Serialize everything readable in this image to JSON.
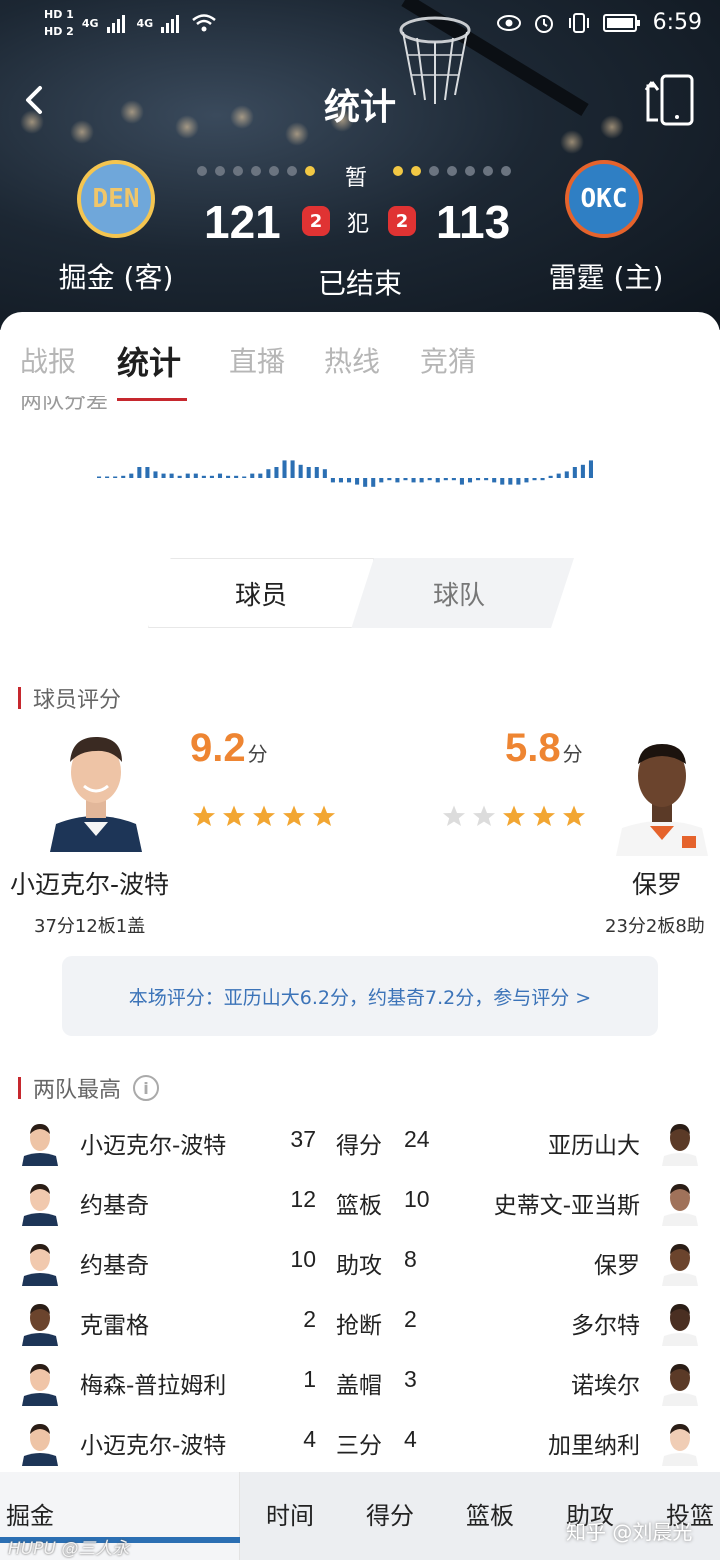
{
  "status_bar": {
    "hd1": "HD 1",
    "hd2": "HD 2",
    "net1": "4G",
    "net2": "4G",
    "time": "6:59"
  },
  "nav": {
    "title": "统计"
  },
  "game": {
    "away": {
      "abbr": "DEN",
      "name": "掘金 (客)",
      "score": "121",
      "fouls": "2",
      "timeouts_total": 7,
      "timeouts_used": 1,
      "logo_color": "#6fa7da"
    },
    "home": {
      "abbr": "OKC",
      "name": "雷霆 (主)",
      "score": "113",
      "fouls": "2",
      "timeouts_total": 7,
      "timeouts_used": 2,
      "logo_color": "#2f7fc4"
    },
    "timeout_label": "暂",
    "foul_label": "犯",
    "status": "已结束"
  },
  "tabs": [
    {
      "label": "战报"
    },
    {
      "label": "统计"
    },
    {
      "label": "直播"
    },
    {
      "label": "热线"
    },
    {
      "label": "竞猜"
    }
  ],
  "diff_section_title": "两队分差",
  "switch": {
    "player": "球员",
    "team": "球队"
  },
  "player_rating": {
    "title": "球员评分",
    "away": {
      "name": "小迈克尔-波特",
      "score": "9.2",
      "unit": "分",
      "stars": 5,
      "line": "37分12板1盖"
    },
    "home": {
      "name": "保罗",
      "score": "5.8",
      "unit": "分",
      "stars": 3,
      "line": "23分2板8助"
    },
    "banner": "本场评分：亚历山大6.2分，约基奇7.2分，参与评分 >"
  },
  "leaders": {
    "title": "两队最高",
    "rows": [
      {
        "away_name": "小迈克尔-波特",
        "away_val": "37",
        "cat": "得分",
        "home_val": "24",
        "home_name": "亚历山大"
      },
      {
        "away_name": "约基奇",
        "away_val": "12",
        "cat": "篮板",
        "home_val": "10",
        "home_name": "史蒂文-亚当斯"
      },
      {
        "away_name": "约基奇",
        "away_val": "10",
        "cat": "助攻",
        "home_val": "8",
        "home_name": "保罗"
      },
      {
        "away_name": "克雷格",
        "away_val": "2",
        "cat": "抢断",
        "home_val": "2",
        "home_name": "多尔特"
      },
      {
        "away_name": "梅森-普拉姆利",
        "away_val": "1",
        "cat": "盖帽",
        "home_val": "3",
        "home_name": "诺埃尔"
      },
      {
        "away_name": "小迈克尔-波特",
        "away_val": "4",
        "cat": "三分",
        "home_val": "4",
        "home_name": "加里纳利"
      }
    ]
  },
  "bottom_table": {
    "team": "掘金",
    "columns": [
      "时间",
      "得分",
      "篮板",
      "助攻",
      "投篮"
    ]
  },
  "watermarks": {
    "left": "HUPU @三人永",
    "right": "知乎 @刘晨光"
  },
  "colors": {
    "accent_red": "#c6282e",
    "rating_orange": "#ee8532",
    "link_blue": "#3b73b8",
    "den_bar": "#2b6fb3"
  }
}
